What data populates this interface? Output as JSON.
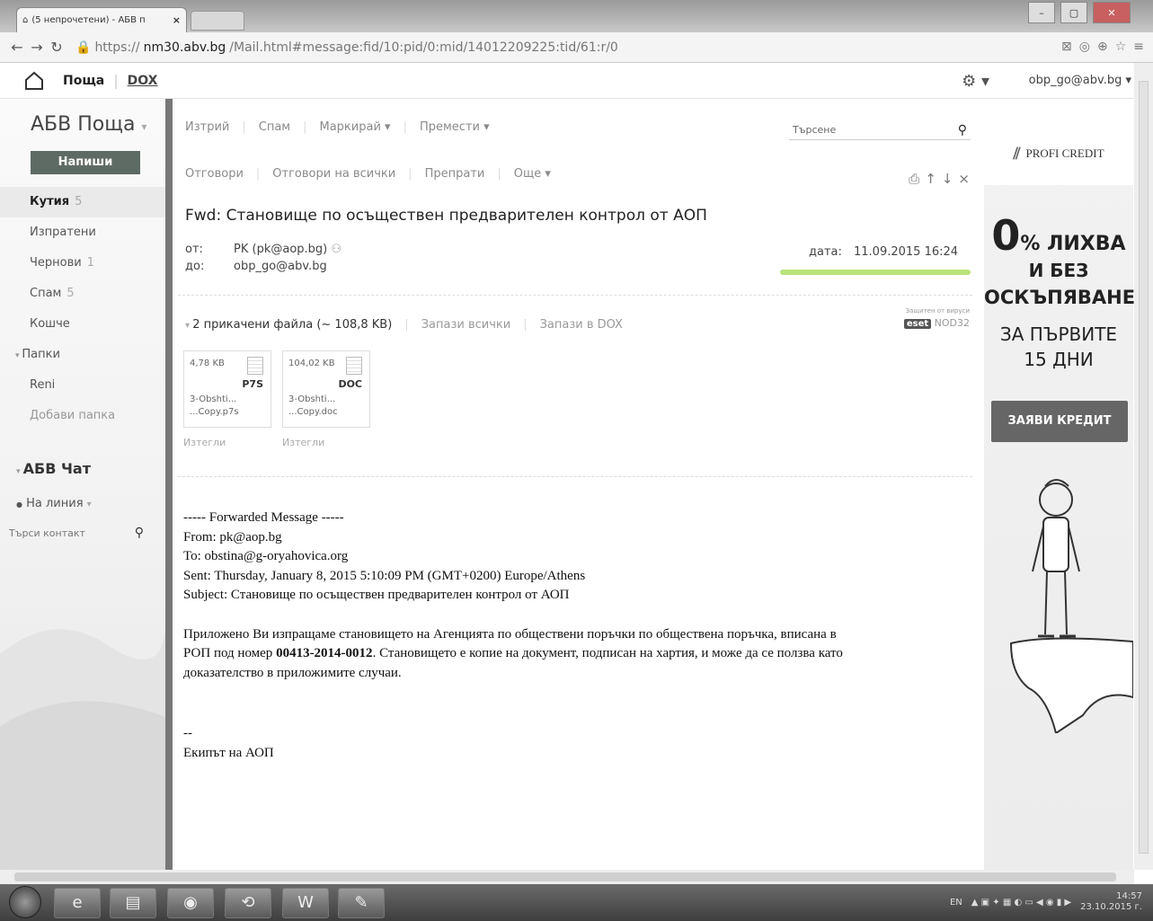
{
  "browser": {
    "tab_title": "(5 непрочетени) - АБВ п",
    "tab_close": "×",
    "url_scheme": "https://",
    "url_host": "nm30.abv.bg",
    "url_path": "/Mail.html#message:fid/10:pid/0:mid/14012209225:tid/61:r/0",
    "window_controls": [
      "–",
      "▢",
      "✕"
    ]
  },
  "mailbar": {
    "brand": "Поща",
    "sep": "|",
    "dox": "DOX",
    "account": "obp_go@abv.bg"
  },
  "sidebar": {
    "title": "АБВ Поща",
    "compose": "Напиши",
    "folders": [
      {
        "label": "Кутия",
        "count": "5"
      },
      {
        "label": "Изпратени",
        "count": ""
      },
      {
        "label": "Чернови",
        "count": "1"
      },
      {
        "label": "Спам",
        "count": "5"
      },
      {
        "label": "Кошче",
        "count": ""
      },
      {
        "label": "Папки",
        "count": ""
      },
      {
        "label": "Reni",
        "count": ""
      },
      {
        "label": "Добави папка",
        "count": ""
      }
    ],
    "chat_title": "АБВ Чат",
    "chat_status": "На линия",
    "contact_search_placeholder": "Търси контакт"
  },
  "toolbar": {
    "delete": "Изтрий",
    "spam": "Спам",
    "mark": "Маркирай",
    "move": "Премести",
    "reply": "Отговори",
    "reply_all": "Отговори на всички",
    "forward": "Препрати",
    "more": "Още",
    "search_placeholder": "Търсене"
  },
  "message": {
    "subject": "Fwd: Становище по осъществен предварителен контрол от АОП",
    "from_label": "от:",
    "from_value": "PK (pk@aop.bg)",
    "to_label": "до:",
    "to_value": "obp_go@abv.bg",
    "date_label": "дата:",
    "date_value": "11.09.2015 16:24",
    "attachments_summary": "2 прикачени файла (~ 108,8 KB)",
    "save_all": "Запази всички",
    "save_dox": "Запази в DOX",
    "antivirus_label": "Защитен от вируси",
    "antivirus_brand": "eset",
    "antivirus_product": "NOD32",
    "attachments": [
      {
        "size": "4,78 KB",
        "ext": "P7S",
        "name1": "3-Obshti...",
        "name2": "...Copy.p7s",
        "action": "Изтегли"
      },
      {
        "size": "104,02 KB",
        "ext": "DOC",
        "name1": "3-Obshti...",
        "name2": "...Copy.doc",
        "action": "Изтегли"
      }
    ],
    "body": {
      "fwd_header": "----- Forwarded Message -----",
      "from": "From: pk@aop.bg",
      "to": "To: obstina@g-oryahovica.org",
      "sent": "Sent: Thursday, January 8, 2015 5:10:09 PM (GMT+0200) Europe/Athens",
      "subject": "Subject: Становище по осъществен предварителен контрол от АОП",
      "para_1": "Приложено Ви изпращаме становището на Агенцията по обществени поръчки по обществена поръчка, вписана в",
      "para_2a": "РОП под номер ",
      "para_2b": "00413-2014-0012",
      "para_2c": ". Становището е копие на документ, подписан на хартия, и може да се ползва като",
      "para_3": "доказателство в приложимите случаи.",
      "sig_sep": "--",
      "signature": "Екипът на АОП"
    }
  },
  "ad": {
    "brand": "PROFI CREDIT",
    "big": "0",
    "line1": "% ЛИХВА",
    "line2": "И БЕЗ",
    "line3": "ОСКЪПЯВАНЕ",
    "line4": "ЗА ПЪРВИТЕ",
    "line5": "15 ДНИ",
    "cta": "ЗАЯВИ КРЕДИТ"
  },
  "taskbar": {
    "lang": "EN",
    "time": "14:57",
    "date": "23.10.2015 г."
  }
}
